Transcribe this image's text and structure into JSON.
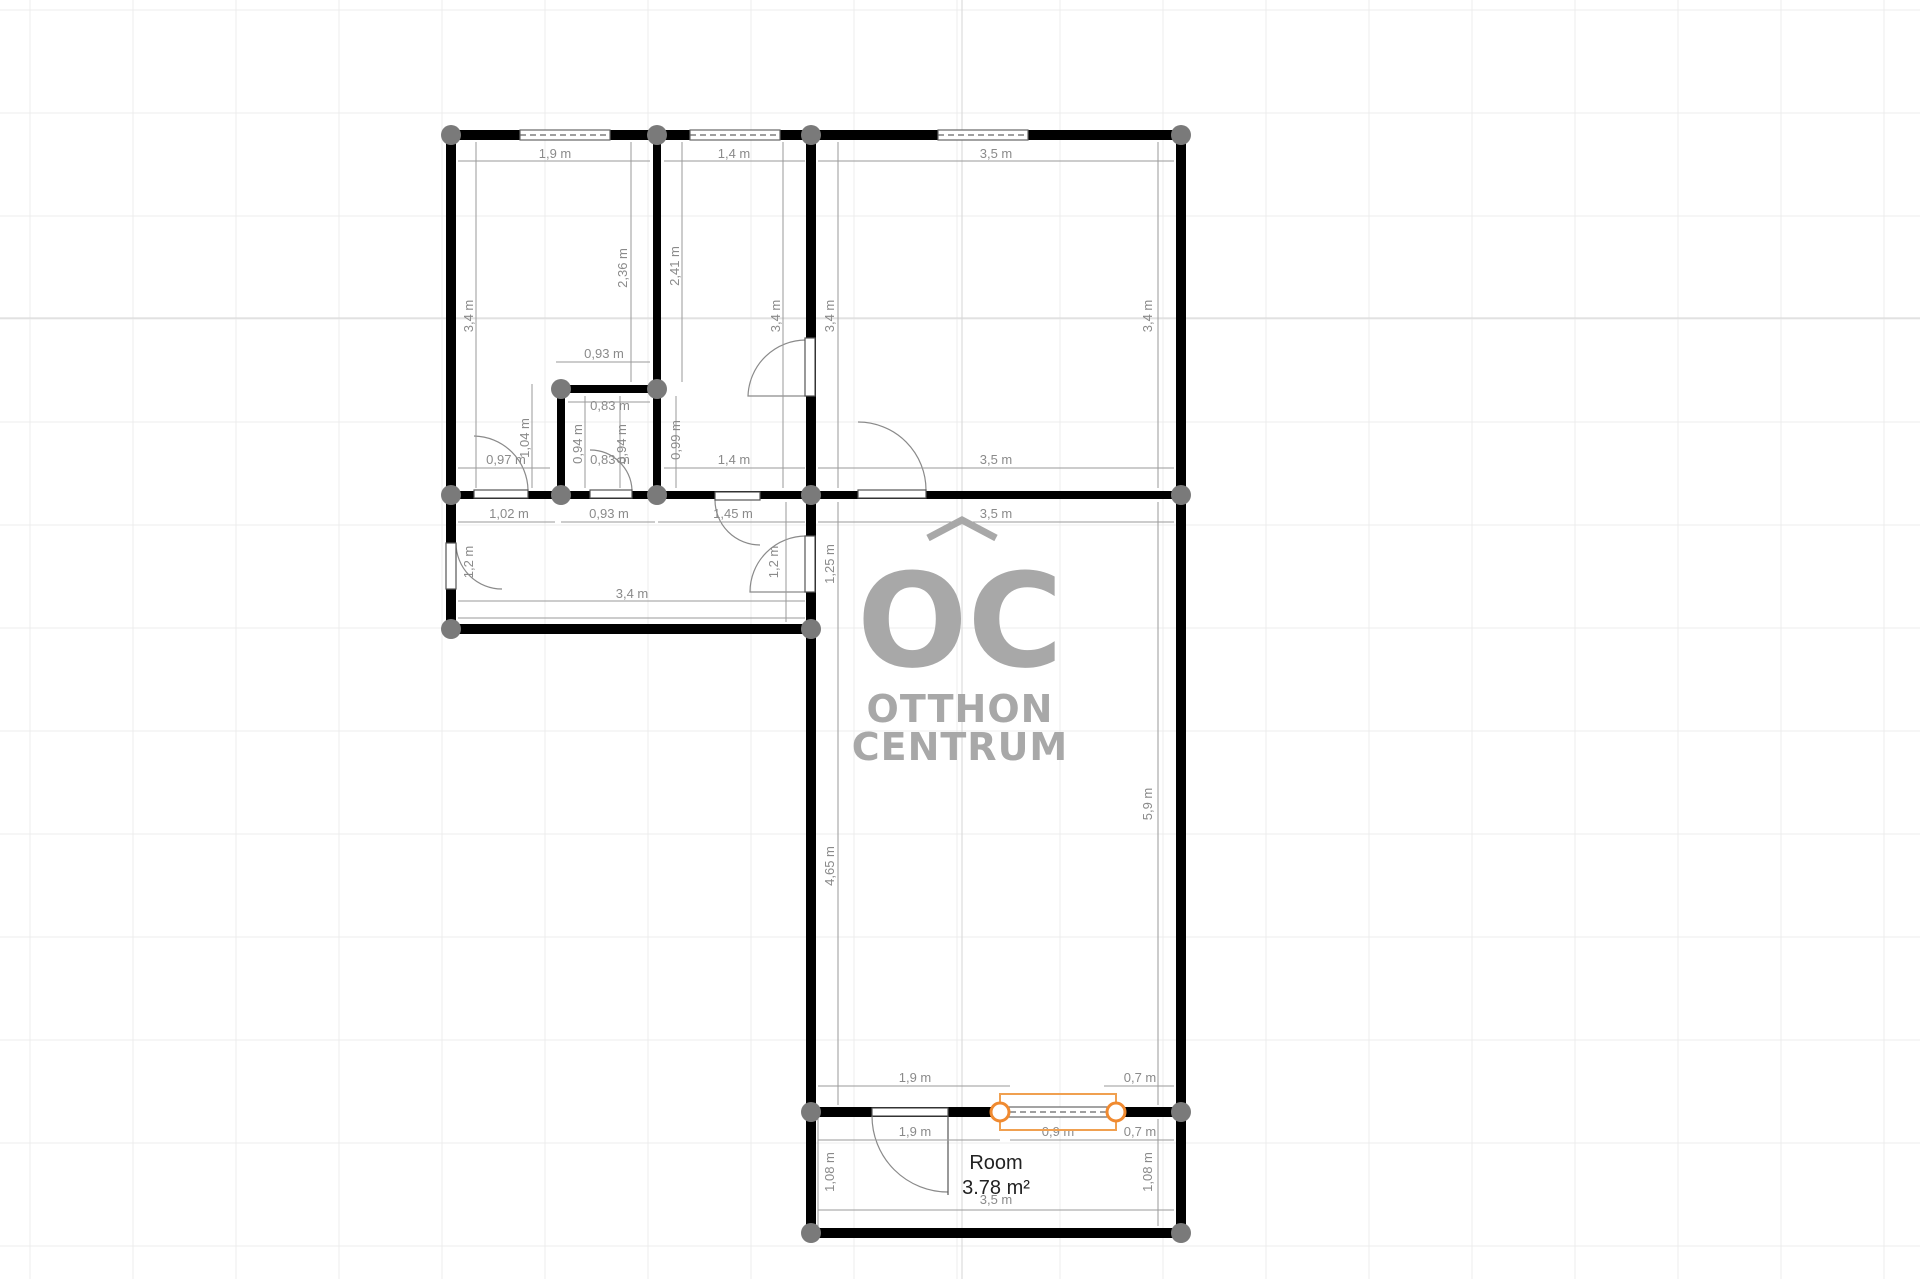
{
  "dimensions": {
    "top_left_width": "1,9 m",
    "top_mid_width": "1,4 m",
    "top_right_width": "3,5 m",
    "left_height": "3,4 m",
    "inner_height_a": "2,36 m",
    "inner_height_b": "2,41 m",
    "mid_right_height": "3,4 m",
    "right_room_left_height": "3,4 m",
    "right_room_right_height": "3,4 m",
    "small_box_top": "0,93 m",
    "small_box_inner": "0,83 m",
    "small_box_h1": "1,04 m",
    "small_box_h2": "0,94 m",
    "small_box_h3": "0,94 m",
    "small_box_bottom": "0,83 m",
    "small_gap_h": "0,99 m",
    "door_width_a": "0,97 m",
    "mid_bottom": "1,4 m",
    "right_bottom": "3,5 m",
    "hall_a": "1,02 m",
    "hall_b": "0,93 m",
    "hall_c": "1,45 m",
    "hall_right": "3,5 m",
    "hall_h_left": "1,2 m",
    "hall_h_right": "1,2 m",
    "hall_h_mid": "1,25 m",
    "hall_bottom": "3,4 m",
    "big_left_height": "4,65 m",
    "big_right_height": "5,9 m",
    "bottom_a": "1,9 m",
    "bottom_b": "0,7 m",
    "bottom_c": "1,9 m",
    "bottom_d": "0,9 m",
    "bottom_e": "0,7 m",
    "balcony_h_left": "1,08 m",
    "balcony_h_right": "1,08 m",
    "balcony_bottom": "3,5 m"
  },
  "room": {
    "name": "Room",
    "area": "3.78 m²"
  },
  "logo": {
    "initials": "OC",
    "line1": "OTTHON",
    "line2": "CENTRUM"
  },
  "colors": {
    "wall": "#000000",
    "node": "#7a7a7a",
    "selection": "#f08a30",
    "dimension": "#8a8a8a"
  }
}
